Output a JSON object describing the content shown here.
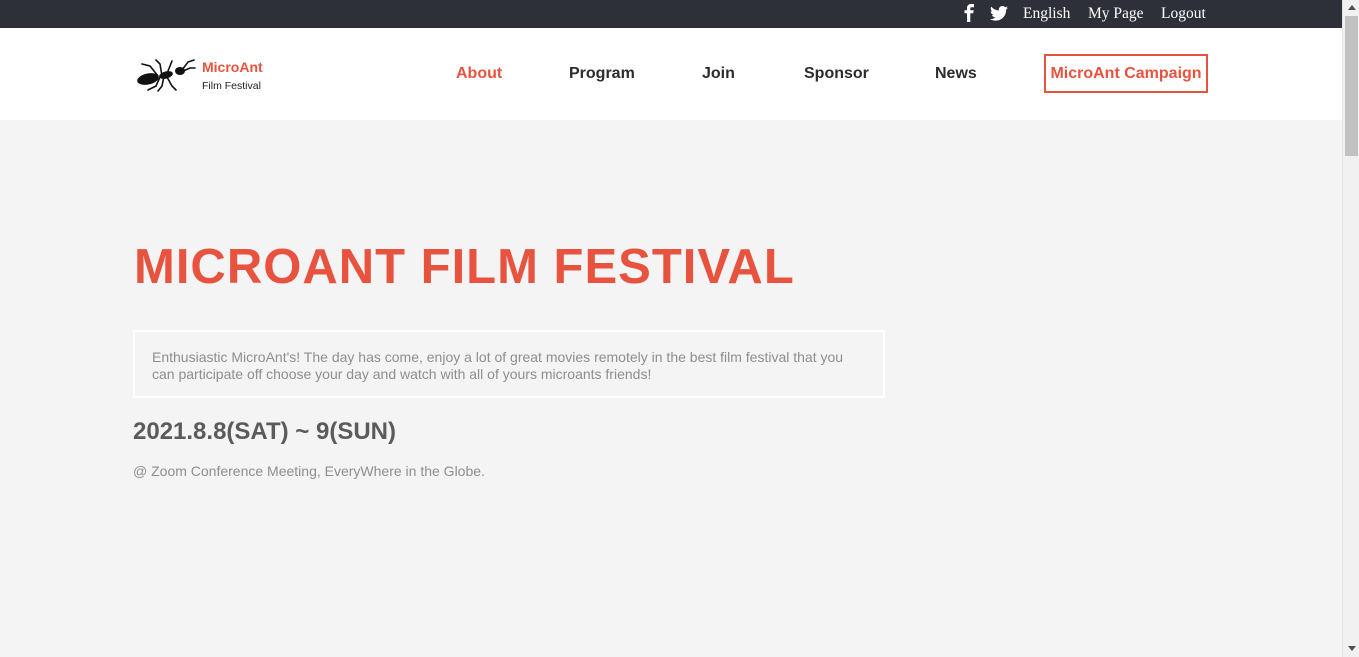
{
  "topbar": {
    "icons": [
      "facebook-icon",
      "twitter-icon"
    ],
    "links": {
      "language": "English",
      "my_page": "My Page",
      "logout": "Logout"
    }
  },
  "logo": {
    "name": "MicroAnt",
    "subtitle": "Film Festival"
  },
  "nav": {
    "about": "About",
    "program": "Program",
    "join": "Join",
    "sponsor": "Sponsor",
    "news": "News",
    "campaign": "MicroAnt Campaign"
  },
  "hero": {
    "title": "MICROANT FILM FESTIVAL",
    "description": "Enthusiastic MicroAnt's! The day has come, enjoy a lot of great movies remotely in the best film festival that you can participate off choose your day and watch with all of yours microants friends!",
    "date": "2021.8.8(SAT) ~ 9(SUN)",
    "venue": "@ Zoom Conference Meeting, EveryWhere in the Globe."
  },
  "colors": {
    "accent": "#e8533f",
    "topbar_bg": "#2e3039",
    "page_bg": "#f4f4f4",
    "header_bg": "#ffffff"
  }
}
